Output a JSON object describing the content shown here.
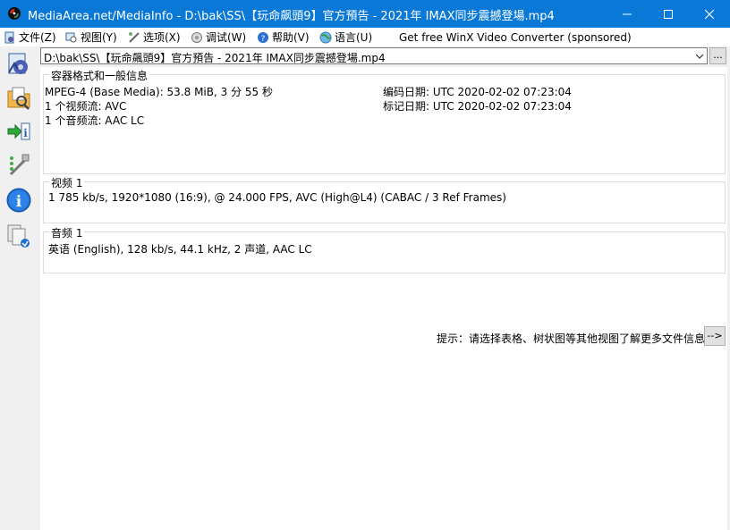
{
  "window": {
    "title": "MediaArea.net/MediaInfo - D:\\bak\\SS\\【玩命飙頭9】官方預告 - 2021年 IMAX同步震撼登場.mp4",
    "accent": "#0a78d7"
  },
  "menu": {
    "file": "文件(Z)",
    "view": "视图(Y)",
    "options": "选项(X)",
    "debug": "调试(W)",
    "help": "帮助(V)",
    "language": "语言(U)",
    "sponsor": "Get free WinX Video Converter (sponsored)"
  },
  "file_selector": {
    "value": "D:\\bak\\SS\\【玩命飆頭9】官方預告 - 2021年 IMAX同步震撼登場.mp4",
    "browse_label": "..."
  },
  "general": {
    "title": "容器格式和一般信息",
    "format": "MPEG-4 (Base Media): 53.8 MiB, 3 分 55 秒",
    "video_count": "1 个视频流: AVC",
    "audio_count": "1 个音频流: AAC LC",
    "encoded_date": "编码日期: UTC 2020-02-02 07:23:04",
    "tagged_date": "标记日期: UTC 2020-02-02 07:23:04"
  },
  "video": {
    "title": "视频 1",
    "info": "1 785 kb/s, 1920*1080 (16:9), @ 24.000 FPS, AVC (High@L4) (CABAC / 3 Ref Frames)"
  },
  "audio": {
    "title": "音频 1",
    "info": "英语 (English), 128 kb/s, 44.1 kHz, 2 声道, AAC LC"
  },
  "hint": {
    "text": "提示：请选择表格、树状图等其他视图了解更多文件信息",
    "button_label": "-->"
  }
}
